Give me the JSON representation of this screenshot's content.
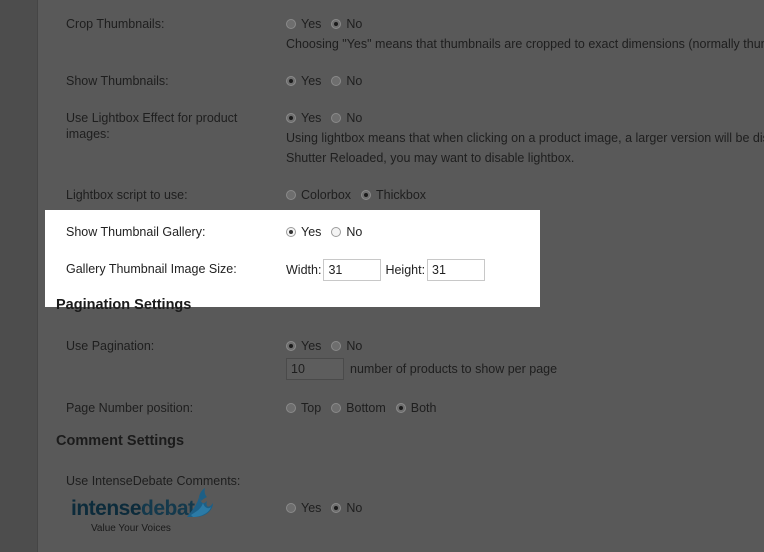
{
  "settings": {
    "crop_thumbnails": {
      "label": "Crop Thumbnails:",
      "options": [
        "Yes",
        "No"
      ],
      "selected": "No",
      "description": "Choosing \"Yes\" means that thumbnails are cropped to exact dimensions (normally thumb"
    },
    "show_thumbnails": {
      "label": "Show Thumbnails:",
      "options": [
        "Yes",
        "No"
      ],
      "selected": "Yes"
    },
    "lightbox_effect": {
      "label_line1": "Use Lightbox Effect for product",
      "label_line2": "images:",
      "options": [
        "Yes",
        "No"
      ],
      "selected": "Yes",
      "description_line1": "Using lightbox means that when clicking on a product image, a larger version will be disp",
      "description_line2": "Shutter Reloaded, you may want to disable lightbox."
    },
    "lightbox_script": {
      "label": "Lightbox script to use:",
      "options": [
        "Colorbox",
        "Thickbox"
      ],
      "selected": "Thickbox"
    },
    "thumbnail_gallery": {
      "label": "Show Thumbnail Gallery:",
      "options": [
        "Yes",
        "No"
      ],
      "selected": "Yes"
    },
    "gallery_thumbnail_size": {
      "label": "Gallery Thumbnail Image Size:",
      "width_label": "Width:",
      "width_value": "31",
      "height_label": "Height:",
      "height_value": "31"
    }
  },
  "pagination": {
    "title": "Pagination Settings",
    "use_pagination": {
      "label": "Use Pagination:",
      "options": [
        "Yes",
        "No"
      ],
      "selected": "Yes",
      "per_page_value": "10",
      "per_page_suffix": "number of products to show per page"
    },
    "page_number_position": {
      "label": "Page Number position:",
      "options": [
        "Top",
        "Bottom",
        "Both"
      ],
      "selected": "Both"
    }
  },
  "comments": {
    "title": "Comment Settings",
    "intensedebate": {
      "label": "Use IntenseDebate Comments:",
      "options": [
        "Yes",
        "No"
      ],
      "selected": "No",
      "logo_word1": "intense",
      "logo_word2": "debate",
      "logo_tagline": "Value Your Voices"
    }
  },
  "colors": {
    "overlay": "#4c4c4c",
    "highlight": "#ffffff",
    "logo_flame": "#1d5f86"
  }
}
